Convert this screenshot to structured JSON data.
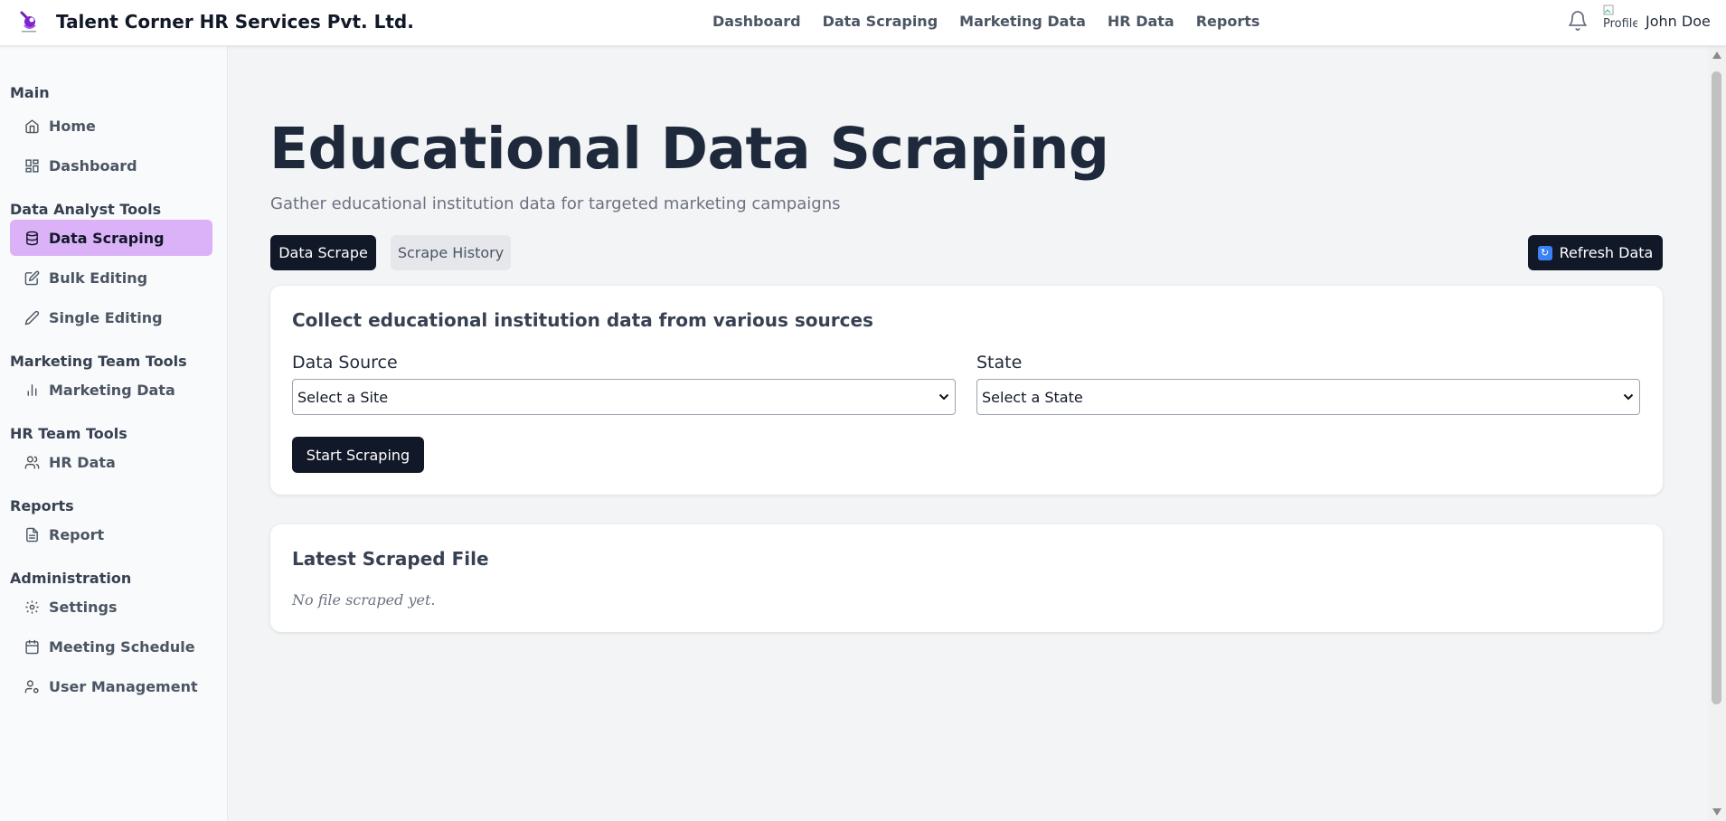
{
  "header": {
    "brand": "Talent Corner HR Services Pvt. Ltd.",
    "logo_icon": "talent-corner-logo",
    "nav": [
      "Dashboard",
      "Data Scraping",
      "Marketing Data",
      "HR Data",
      "Reports"
    ],
    "avatar_alt": "Profile",
    "username": "John Doe"
  },
  "sidebar": {
    "sections": [
      {
        "title": "Main",
        "items": [
          {
            "label": "Home",
            "icon": "home-icon"
          },
          {
            "label": "Dashboard",
            "icon": "grid-icon"
          }
        ]
      },
      {
        "title": "Data Analyst Tools",
        "items": [
          {
            "label": "Data Scraping",
            "icon": "database-icon",
            "active": true
          },
          {
            "label": "Bulk Editing",
            "icon": "edit-square-icon"
          },
          {
            "label": "Single Editing",
            "icon": "pencil-icon"
          }
        ]
      },
      {
        "title": "Marketing Team Tools",
        "items": [
          {
            "label": "Marketing Data",
            "icon": "bar-chart-icon"
          }
        ]
      },
      {
        "title": "HR Team Tools",
        "items": [
          {
            "label": "HR Data",
            "icon": "users-icon"
          }
        ]
      },
      {
        "title": "Reports",
        "items": [
          {
            "label": "Report",
            "icon": "file-text-icon"
          }
        ]
      },
      {
        "title": "Administration",
        "items": [
          {
            "label": "Settings",
            "icon": "gear-icon"
          },
          {
            "label": "Meeting Schedule",
            "icon": "calendar-icon"
          },
          {
            "label": "User Management",
            "icon": "user-cog-icon"
          }
        ]
      }
    ]
  },
  "main": {
    "title": "Educational Data Scraping",
    "subtitle": "Gather educational institution data for targeted marketing campaigns",
    "tabs": [
      "Data Scrape",
      "Scrape History"
    ],
    "refresh_label": "Refresh Data",
    "scrape_card": {
      "heading": "Collect educational institution data from various sources",
      "source_label": "Data Source",
      "source_value": "Select a Site",
      "state_label": "State",
      "state_value": "Select a State",
      "start_label": "Start Scraping"
    },
    "latest_card": {
      "heading": "Latest Scraped File",
      "empty_message": "No file scraped yet."
    }
  },
  "colors": {
    "active_sidebar_bg": "#dbb1f7",
    "dark_button": "#111827",
    "page_bg": "#f3f4f6"
  }
}
